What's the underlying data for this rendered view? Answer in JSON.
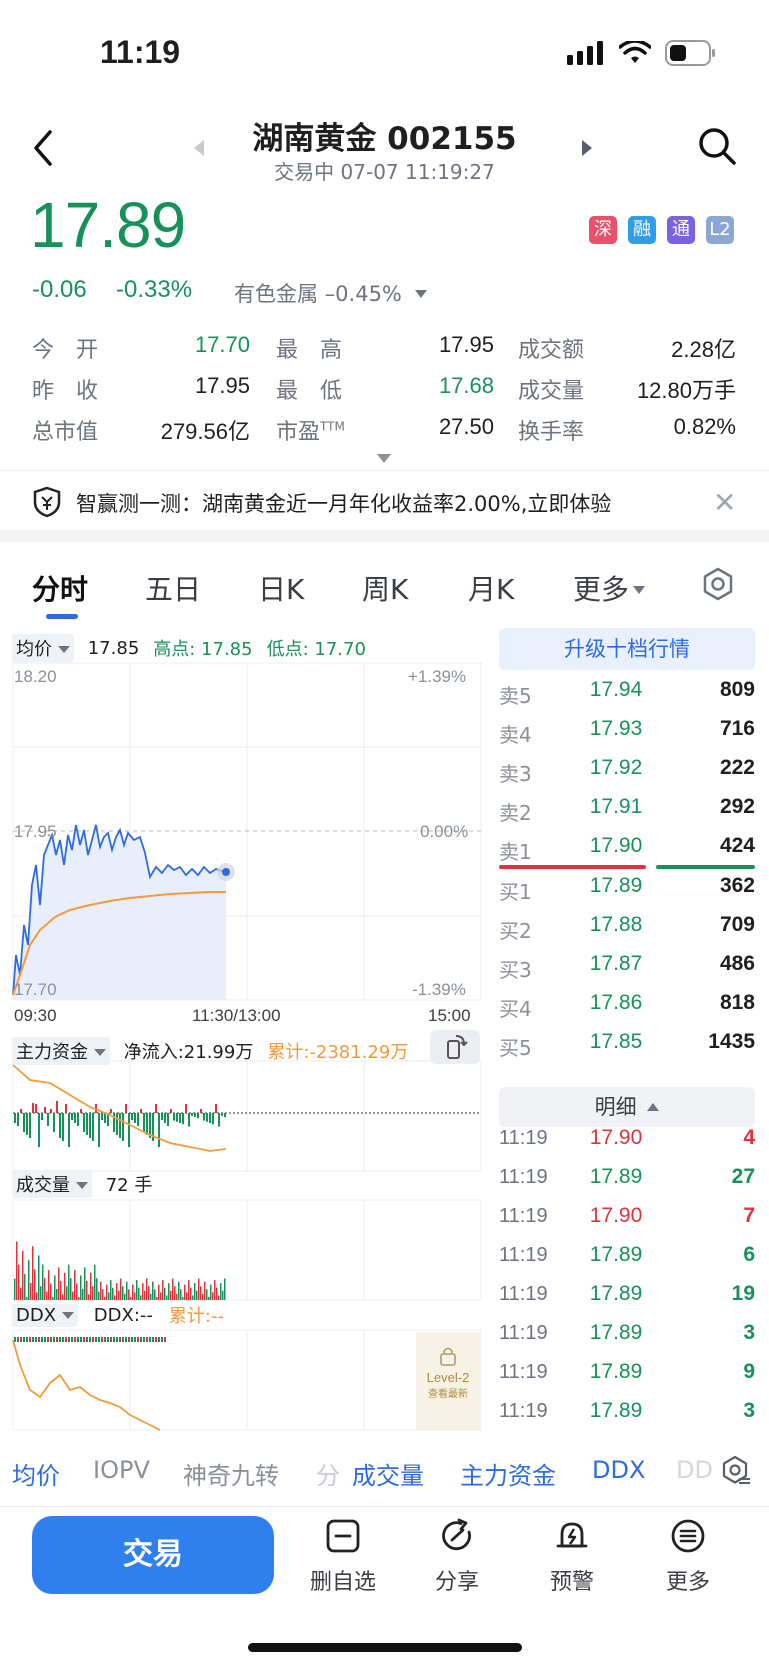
{
  "status": {
    "time": "11:19"
  },
  "header": {
    "title": "湖南黄金 002155",
    "subtitle": "交易中 07-07 11:19:27"
  },
  "quote": {
    "price": "17.89",
    "change_abs": "-0.06",
    "change_pct": "-0.33%",
    "sector": "有色金属 –0.45%",
    "badges": [
      {
        "label": "深",
        "color": "#e8506b"
      },
      {
        "label": "融",
        "color": "#2f9ee6"
      },
      {
        "label": "通",
        "color": "#7b62e0"
      },
      {
        "label": "L2",
        "color": "#8aa7d6"
      }
    ]
  },
  "stats": [
    {
      "label": "今　开",
      "value": "17.70",
      "color": "green"
    },
    {
      "label": "最　高",
      "value": "17.95",
      "color": "dark"
    },
    {
      "label": "成交额",
      "value": "2.28亿",
      "color": "dark"
    },
    {
      "label": "昨　收",
      "value": "17.95",
      "color": "dark"
    },
    {
      "label": "最　低",
      "value": "17.68",
      "color": "green"
    },
    {
      "label": "成交量",
      "value": "12.80万手",
      "color": "dark"
    },
    {
      "label": "总市值",
      "value": "279.56亿",
      "color": "dark"
    },
    {
      "label": "市盈",
      "label_sup": "TTM",
      "value": "27.50",
      "color": "dark"
    },
    {
      "label": "换手率",
      "value": "0.82%",
      "color": "dark"
    }
  ],
  "banner": {
    "text": "智赢测一测：湖南黄金近一月年化收益率2.00%,立即体验"
  },
  "tabs": [
    "分时",
    "五日",
    "日K",
    "周K",
    "月K",
    "更多"
  ],
  "chart": {
    "selector": "均价",
    "avg_value": "17.85",
    "high_label": "高点: 17.85",
    "low_label": "低点: 17.70",
    "y_top": "18.20",
    "y_mid": "17.95",
    "y_bottom": "17.70",
    "pct_top": "+1.39%",
    "pct_mid": "0.00%",
    "pct_bottom": "-1.39%",
    "x_start": "09:30",
    "x_mid": "11:30/13:00",
    "x_end": "15:00"
  },
  "capital": {
    "selector": "主力资金",
    "net_inflow": "净流入:21.99万",
    "cumulative": "累计:-2381.29万"
  },
  "volume": {
    "selector": "成交量",
    "value": "72 手"
  },
  "ddx": {
    "selector": "DDX",
    "value": "DDX:--",
    "cumulative": "累计:--",
    "lock_title": "Level-2",
    "lock_sub": "查看最新"
  },
  "orderbook": {
    "upgrade": "升级十档行情",
    "asks": [
      {
        "label": "卖5",
        "price": "17.94",
        "vol": "809"
      },
      {
        "label": "卖4",
        "price": "17.93",
        "vol": "716"
      },
      {
        "label": "卖3",
        "price": "17.92",
        "vol": "222"
      },
      {
        "label": "卖2",
        "price": "17.91",
        "vol": "292"
      },
      {
        "label": "卖1",
        "price": "17.90",
        "vol": "424"
      }
    ],
    "bids": [
      {
        "label": "买1",
        "price": "17.89",
        "vol": "362"
      },
      {
        "label": "买2",
        "price": "17.88",
        "vol": "709"
      },
      {
        "label": "买3",
        "price": "17.87",
        "vol": "486"
      },
      {
        "label": "买4",
        "price": "17.86",
        "vol": "818"
      },
      {
        "label": "买5",
        "price": "17.85",
        "vol": "1435"
      }
    ],
    "detail_label": "明细",
    "ticks": [
      {
        "time": "11:19",
        "price": "17.90",
        "vol": "4",
        "color": "red"
      },
      {
        "time": "11:19",
        "price": "17.89",
        "vol": "27",
        "color": "green"
      },
      {
        "time": "11:19",
        "price": "17.90",
        "vol": "7",
        "color": "red"
      },
      {
        "time": "11:19",
        "price": "17.89",
        "vol": "6",
        "color": "green"
      },
      {
        "time": "11:19",
        "price": "17.89",
        "vol": "19",
        "color": "green"
      },
      {
        "time": "11:19",
        "price": "17.89",
        "vol": "3",
        "color": "green"
      },
      {
        "time": "11:19",
        "price": "17.89",
        "vol": "9",
        "color": "green"
      },
      {
        "time": "11:19",
        "price": "17.89",
        "vol": "3",
        "color": "green"
      }
    ]
  },
  "indicator_tabs": [
    "均价",
    "IOPV",
    "神奇九转",
    "分",
    "成交量",
    "主力资金",
    "DDX",
    "DD"
  ],
  "bottom_bar": {
    "trade": "交易",
    "items": [
      "删自选",
      "分享",
      "预警",
      "更多"
    ]
  }
}
